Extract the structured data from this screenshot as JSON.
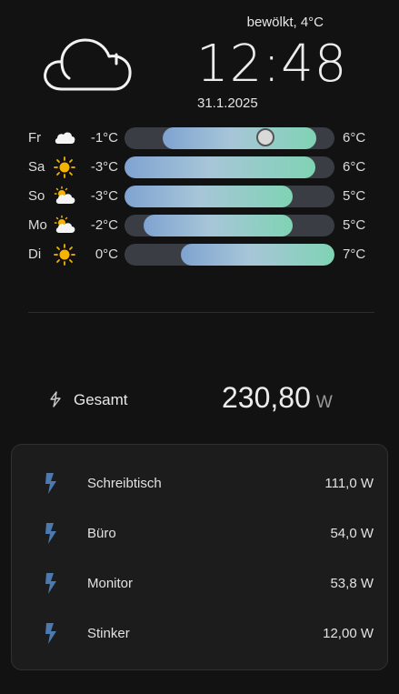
{
  "header": {
    "condition": "bewölkt, 4°C",
    "time": "12:48",
    "date": "31.1.2025",
    "icon": "cloudy-icon"
  },
  "forecast": [
    {
      "day": "Fr",
      "icon": "cloud-icon",
      "min": "-1°C",
      "max": "6°C",
      "range_start": 0.18,
      "range_end": 0.91,
      "current": 0.67
    },
    {
      "day": "Sa",
      "icon": "sun-icon",
      "min": "-3°C",
      "max": "6°C",
      "range_start": 0.0,
      "range_end": 0.91
    },
    {
      "day": "So",
      "icon": "partly-cloudy-icon",
      "min": "-3°C",
      "max": "5°C",
      "range_start": 0.0,
      "range_end": 0.8
    },
    {
      "day": "Mo",
      "icon": "partly-cloudy-icon",
      "min": "-2°C",
      "max": "5°C",
      "range_start": 0.09,
      "range_end": 0.8
    },
    {
      "day": "Di",
      "icon": "sun-icon",
      "min": "0°C",
      "max": "7°C",
      "range_start": 0.27,
      "range_end": 1.0
    }
  ],
  "total": {
    "label": "Gesamt",
    "value": "230,80",
    "unit": "W"
  },
  "devices": [
    {
      "name": "Schreibtisch",
      "value": "111,0 W"
    },
    {
      "name": "Büro",
      "value": "54,0 W"
    },
    {
      "name": "Monitor",
      "value": "53,8 W"
    },
    {
      "name": "Stinker",
      "value": "12,00 W"
    }
  ],
  "colors": {
    "background": "#121212",
    "card": "#1c1c1c",
    "bolt": "#4a7ab0",
    "sun": "#f5b400",
    "gradient_start": "#7fa3d1",
    "gradient_end": "#7fd3b4"
  }
}
